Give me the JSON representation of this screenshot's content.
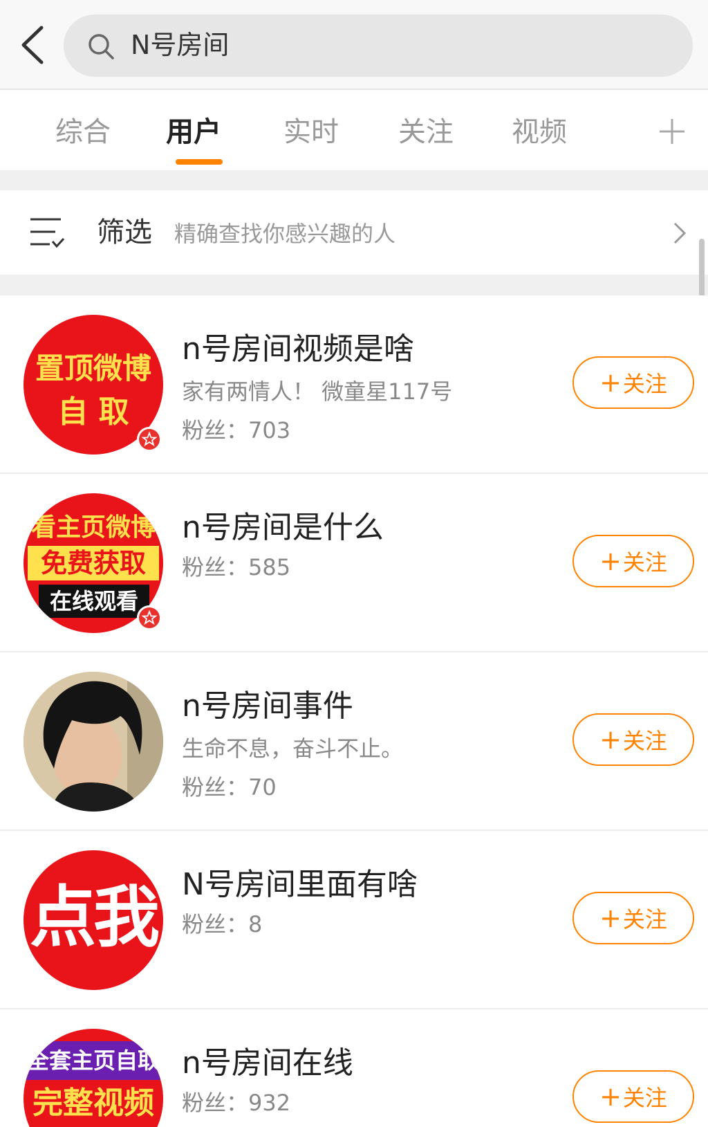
{
  "header": {
    "search_text": "N号房间"
  },
  "tabs": [
    {
      "label": "综合"
    },
    {
      "label": "用户"
    },
    {
      "label": "实时"
    },
    {
      "label": "关注"
    },
    {
      "label": "视频"
    }
  ],
  "filter": {
    "label": "筛选",
    "description": "精确查找你感兴趣的人"
  },
  "users": [
    {
      "name": "n号房间视频是啥",
      "bio": "家有两情人！ 微童星117号",
      "fans": "粉丝：703",
      "avatar_lines": [
        "置顶微博",
        "自 取"
      ]
    },
    {
      "name": "n号房间是什么",
      "bio": "",
      "fans": "粉丝：585",
      "avatar_lines": [
        "看主页微博",
        "免费获取",
        "在线观看"
      ]
    },
    {
      "name": "n号房间事件",
      "bio": "生命不息，奋斗不止。",
      "fans": "粉丝：70",
      "avatar_lines": []
    },
    {
      "name": "N号房间里面有啥",
      "bio": "",
      "fans": "粉丝：8",
      "avatar_lines": [
        "点我"
      ]
    },
    {
      "name": "n号房间在线",
      "bio": "",
      "fans": "粉丝：932",
      "avatar_lines": [
        "全套主页自取",
        "完整视频"
      ]
    }
  ],
  "follow_label": "关注",
  "colors": {
    "accent": "#ff8200",
    "avatar_red": "#e8141a",
    "text_gray": "#888888"
  }
}
